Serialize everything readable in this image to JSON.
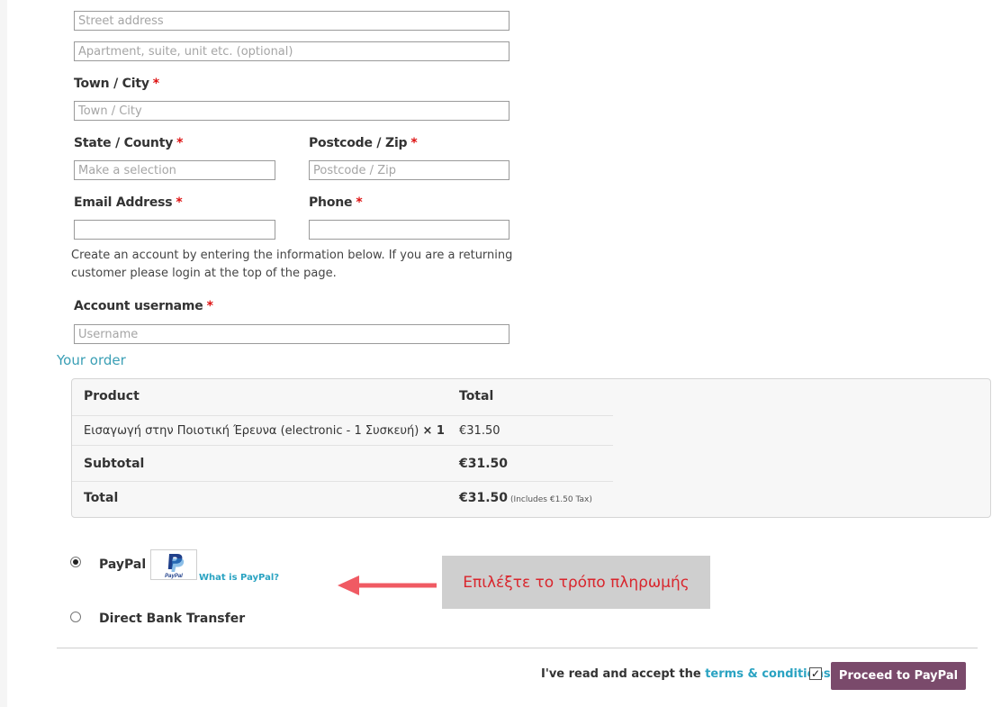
{
  "billing": {
    "street_placeholder": "Street address",
    "apartment_placeholder": "Apartment, suite, unit etc. (optional)",
    "town_label": "Town / City",
    "town_placeholder": "Town / City",
    "state_label": "State / County",
    "state_placeholder": "Make a selection",
    "postcode_label": "Postcode / Zip",
    "postcode_placeholder": "Postcode / Zip",
    "email_label": "Email Address",
    "phone_label": "Phone",
    "required_mark": "*",
    "account_hint_line1": "Create an account by entering the information below. If you are a returning",
    "account_hint_line2": "customer please login at the top of the page.",
    "username_label": "Account username",
    "username_placeholder": "Username"
  },
  "order": {
    "heading": "Your order",
    "columns": [
      "Product",
      "Total"
    ],
    "item": {
      "name": "Εισαγωγή στην Ποιοτική Έρευνα (electronic - 1 Συσκευή)",
      "qty": "× 1",
      "total": "€31.50"
    },
    "subtotal_label": "Subtotal",
    "subtotal_value": "€31.50",
    "total_label": "Total",
    "total_value": "€31.50",
    "tax_note": "(Includes €1.50 Tax)"
  },
  "payment": {
    "paypal_label": "PayPal",
    "paypal_logo_text": "PayPal",
    "what_is_paypal": "What is PayPal?",
    "bank_label": "Direct Bank Transfer",
    "selected": "PayPal"
  },
  "callout": {
    "text": "Επιλέξτε το τρόπο πληρωμής",
    "color": "#d9262d"
  },
  "footer": {
    "terms_prefix": "I've read and accept the",
    "terms_link": "terms & conditions",
    "checkbox_mark": "✓",
    "proceed_button": "Proceed to PayPal"
  },
  "colors": {
    "accent": "#2aa3c2",
    "button": "#7a4a6b"
  }
}
